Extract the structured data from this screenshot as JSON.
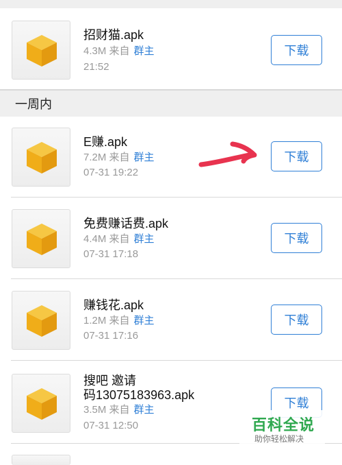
{
  "sections": {
    "week_label": "一周内"
  },
  "files": [
    {
      "name": "招财猫.apk",
      "size": "4.3M",
      "source_prefix": "来自",
      "source": "群主",
      "time": "21:52",
      "action": "下载"
    },
    {
      "name": "E赚.apk",
      "size": "7.2M",
      "source_prefix": "来自",
      "source": "群主",
      "time": "07-31 19:22",
      "action": "下载"
    },
    {
      "name": "免费赚话费.apk",
      "size": "4.4M",
      "source_prefix": "来自",
      "source": "群主",
      "time": "07-31 17:18",
      "action": "下载"
    },
    {
      "name": "赚钱花.apk",
      "size": "1.2M",
      "source_prefix": "来自",
      "source": "群主",
      "time": "07-31 17:16",
      "action": "下载"
    },
    {
      "name_line1": "搜吧 邀请",
      "name_line2": "码13075183963.apk",
      "size": "3.5M",
      "source_prefix": "来自",
      "source": "群主",
      "time": "07-31 12:50",
      "action": "下载"
    }
  ],
  "watermark": {
    "title": "百科全说",
    "subtitle": "助你轻松解决"
  },
  "colors": {
    "accent": "#2f7fd6",
    "annotation_arrow": "#e8334f",
    "icon": "#f2b21f"
  }
}
